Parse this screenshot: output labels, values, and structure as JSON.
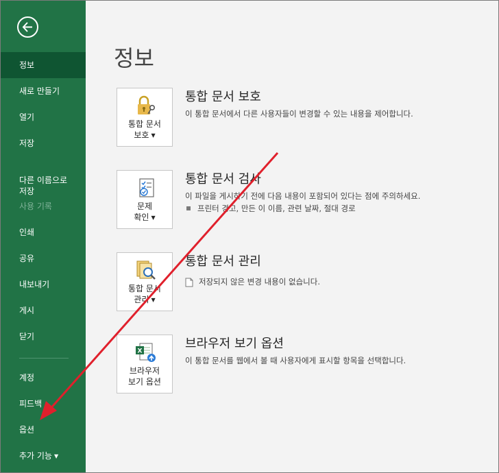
{
  "sidebar": {
    "back_icon": "back-arrow-icon",
    "items": [
      {
        "label": "정보",
        "active": true
      },
      {
        "label": "새로 만들기"
      },
      {
        "label": "열기"
      },
      {
        "label": "저장"
      },
      {
        "label": "다른 이름으로\n저장"
      },
      {
        "label": "사용 기록",
        "disabled": true
      },
      {
        "label": "인쇄"
      },
      {
        "label": "공유"
      },
      {
        "label": "내보내기"
      },
      {
        "label": "게시"
      },
      {
        "label": "닫기"
      },
      {
        "label": "계정"
      },
      {
        "label": "피드백"
      },
      {
        "label": "옵션"
      },
      {
        "label": "추가 기능"
      }
    ]
  },
  "main": {
    "title": "정보",
    "sections": [
      {
        "button_label": "통합 문서\n보호",
        "icon": "lock-key-icon",
        "title": "통합 문서 보호",
        "description": "이 통합 문서에서 다른 사용자들이 변경할 수 있는 내용을 제어합니다."
      },
      {
        "button_label": "문제\n확인",
        "icon": "checklist-icon",
        "title": "통합 문서 검사",
        "description": "이 파일을 게시하기 전에 다음 내용이 포함되어 있다는 점에 주의하세요.",
        "bullet": "프린터 경고, 만든 이 이름, 관련 날짜, 절대 경로"
      },
      {
        "button_label": "통합 문서\n관리",
        "icon": "manage-documents-icon",
        "title": "통합 문서 관리",
        "description": "저장되지 않은 변경 내용이 없습니다."
      },
      {
        "button_label": "브라우저\n보기 옵션",
        "icon": "excel-browser-icon",
        "title": "브라우저 보기 옵션",
        "description": "이 통합 문서를 웹에서 볼 때 사용자에게 표시할 항목을 선택합니다."
      }
    ]
  },
  "colors": {
    "sidebar": "#217346",
    "sidebar_active": "#0f5532",
    "annotation_arrow": "#e0202c"
  }
}
